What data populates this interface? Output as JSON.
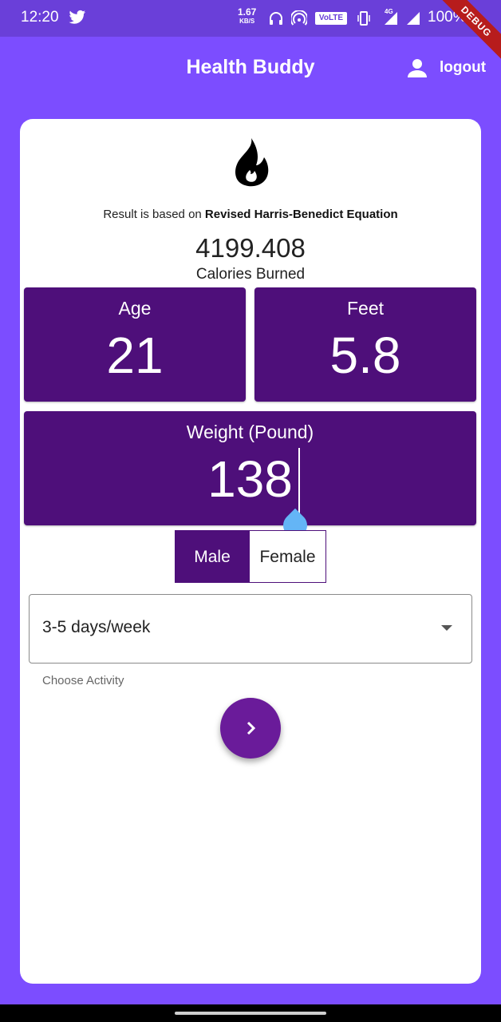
{
  "status_bar": {
    "time": "12:20",
    "net_speed": "1.67",
    "net_speed_unit": "KB/S",
    "volte": "VoLTE",
    "network": "4G",
    "battery": "100%",
    "debug": "DEBUG"
  },
  "app_bar": {
    "title": "Health Buddy",
    "logout_label": "logout"
  },
  "result": {
    "equation_prefix": "Result is based on ",
    "equation_name": "Revised Harris-Benedict Equation",
    "calories_value": "4199.408",
    "calories_label": "Calories Burned"
  },
  "inputs": {
    "age_label": "Age",
    "age_value": "21",
    "feet_label": "Feet",
    "feet_value": "5.8",
    "weight_label": "Weight (Pound)",
    "weight_value": "138"
  },
  "gender": {
    "male": "Male",
    "female": "Female",
    "selected": "Male"
  },
  "activity": {
    "selected": "3-5 days/week",
    "helper": "Choose Activity"
  },
  "colors": {
    "background": "#7c4dff",
    "tile": "#4e0f7a",
    "fab": "#6a1b9a",
    "cursor_handle": "#64b5f6"
  }
}
